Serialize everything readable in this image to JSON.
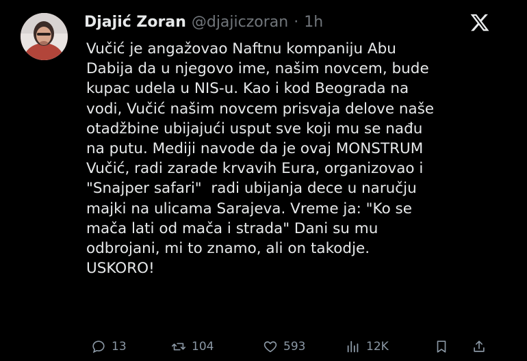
{
  "author": {
    "name": "Djajić Zoran",
    "handle": "@djajiczoran",
    "separator": "·",
    "time": "1h"
  },
  "platform_logo": "x-logo-icon",
  "post": {
    "lines": [
      "Vučić je angažovao Naftnu kompaniju Abu",
      "Dabija da u njegovo ime, našim novcem, bude",
      "kupac udela u NIS-u. Kao i kod Beograda na",
      "vodi, Vučić našim novcem prisvaja delove naše",
      "otadžbine ubijajući usput sve koji mu se nađu",
      "na putu. Mediji navode da je ovaj MONSTRUM",
      "Vučić, radi zarade krvavih Eura, organizovao i",
      "\"Snajper safari\"  radi ubijanja dece u naručju",
      "majki na ulicama Sarajeva. Vreme ja: \"Ko se",
      "mača lati od mača i strada\" Dani su mu",
      "odbrojani, mi to znamo, ali on takodje.",
      "USKORO!"
    ]
  },
  "actions": {
    "replies": "13",
    "reposts": "104",
    "likes": "593",
    "views": "12K"
  },
  "colors": {
    "background": "#000000",
    "text": "#e7e9ea",
    "secondary": "#71767b",
    "action": "#8b98a5"
  }
}
